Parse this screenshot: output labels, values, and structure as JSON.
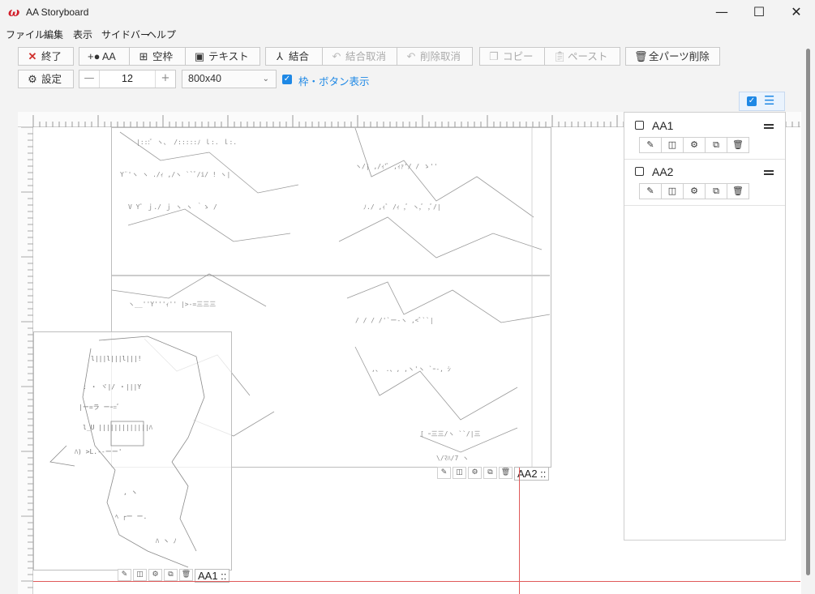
{
  "window": {
    "logo_glyph": "ω",
    "title": "AA Storyboard",
    "minimize_glyph": "—",
    "maximize_glyph": "☐",
    "close_glyph": "✕"
  },
  "menu": [
    "ファイル",
    "編集",
    "表示",
    "サイドバー",
    "ヘルプ"
  ],
  "toolbar": {
    "exit_label": "終了",
    "aa_label": "AA",
    "blank_frame_label": "空枠",
    "text_label": "テキスト",
    "merge_label": "結合",
    "unmerge_label": "結合取消",
    "undo_delete_label": "削除取消",
    "copy_label": "コピー",
    "paste_label": "ペースト",
    "delete_all_label": "全パーツ削除",
    "settings_label": "設定",
    "font_size_value": "12",
    "stepper_minus": "—",
    "stepper_plus": "+",
    "size_select_value": "800x40",
    "frame_button_toggle_label": "枠・ボタン表示"
  },
  "panels": [
    {
      "label": "AA1 ::"
    },
    {
      "label": "AA2 ::"
    }
  ],
  "sidebar": {
    "items": [
      {
        "name": "AA1"
      },
      {
        "name": "AA2"
      }
    ]
  },
  "colors": {
    "accent": "#1e88e5",
    "danger": "#d0312d",
    "guide_line": "#e05a5a"
  }
}
